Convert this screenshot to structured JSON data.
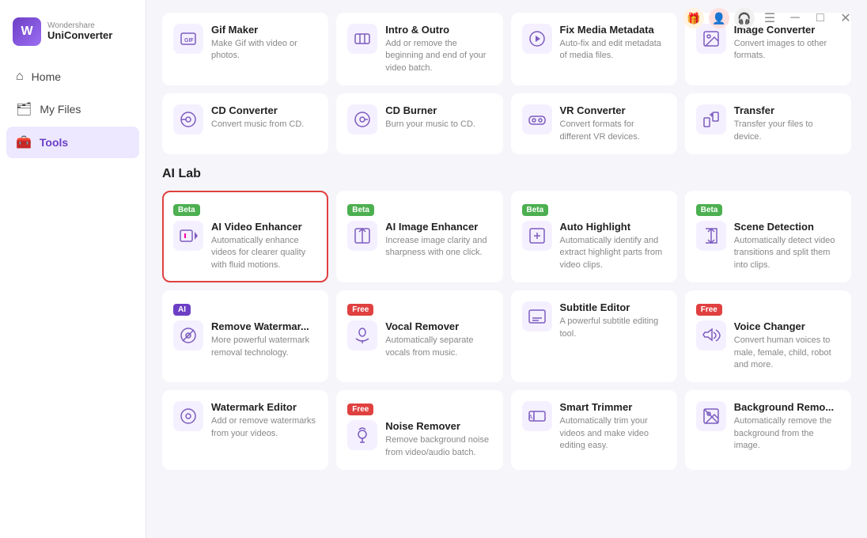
{
  "app": {
    "brand": "Wondershare",
    "product": "UniConverter"
  },
  "titlebar": {
    "gift": "🎁",
    "user": "👤",
    "support": "🎧",
    "menu": "☰",
    "minimize": "─",
    "maximize": "□",
    "close": "✕"
  },
  "sidebar": {
    "items": [
      {
        "id": "home",
        "label": "Home",
        "icon": "⌂"
      },
      {
        "id": "my-files",
        "label": "My Files",
        "icon": "🗂"
      },
      {
        "id": "tools",
        "label": "Tools",
        "icon": "🧰",
        "active": true
      }
    ]
  },
  "sections": [
    {
      "id": "more-tools",
      "title": "",
      "cards": [
        {
          "id": "gif-maker",
          "title": "Gif Maker",
          "desc": "Make Gif with video or photos.",
          "badge": null
        },
        {
          "id": "intro-outro",
          "title": "Intro & Outro",
          "desc": "Add or remove the beginning and end of your video batch.",
          "badge": null
        },
        {
          "id": "fix-media-metadata",
          "title": "Fix Media Metadata",
          "desc": "Auto-fix and edit metadata of media files.",
          "badge": null
        },
        {
          "id": "image-converter",
          "title": "Image Converter",
          "desc": "Convert images to other formats.",
          "badge": null
        },
        {
          "id": "cd-converter",
          "title": "CD Converter",
          "desc": "Convert music from CD.",
          "badge": null
        },
        {
          "id": "cd-burner",
          "title": "CD Burner",
          "desc": "Burn your music to CD.",
          "badge": null
        },
        {
          "id": "vr-converter",
          "title": "VR Converter",
          "desc": "Convert formats for different VR devices.",
          "badge": null
        },
        {
          "id": "transfer",
          "title": "Transfer",
          "desc": "Transfer your files to device.",
          "badge": null
        }
      ]
    },
    {
      "id": "ai-lab",
      "title": "AI Lab",
      "cards": [
        {
          "id": "ai-video-enhancer",
          "title": "AI Video Enhancer",
          "desc": "Automatically enhance videos for clearer quality with fluid motions.",
          "badge": "Beta",
          "highlighted": true
        },
        {
          "id": "ai-image-enhancer",
          "title": "AI Image Enhancer",
          "desc": "Increase image clarity and sharpness with one click.",
          "badge": "Beta"
        },
        {
          "id": "auto-highlight",
          "title": "Auto Highlight",
          "desc": "Automatically identify and extract highlight parts from video clips.",
          "badge": "Beta"
        },
        {
          "id": "scene-detection",
          "title": "Scene Detection",
          "desc": "Automatically detect video transitions and split them into clips.",
          "badge": "Beta"
        },
        {
          "id": "remove-watermark",
          "title": "Remove Watermar...",
          "desc": "More powerful watermark removal technology.",
          "badge": "AI"
        },
        {
          "id": "vocal-remover",
          "title": "Vocal Remover",
          "desc": "Automatically separate vocals from music.",
          "badge": "Free"
        },
        {
          "id": "subtitle-editor",
          "title": "Subtitle Editor",
          "desc": "A powerful subtitle editing tool.",
          "badge": null
        },
        {
          "id": "voice-changer",
          "title": "Voice Changer",
          "desc": "Convert human voices to male, female, child, robot and more.",
          "badge": "Free"
        },
        {
          "id": "watermark-editor",
          "title": "Watermark Editor",
          "desc": "Add or remove watermarks from your videos.",
          "badge": null
        },
        {
          "id": "noise-remover",
          "title": "Noise Remover",
          "desc": "Remove background noise from video/audio batch.",
          "badge": "Free"
        },
        {
          "id": "smart-trimmer",
          "title": "Smart Trimmer",
          "desc": "Automatically trim your videos and make video editing easy.",
          "badge": null
        },
        {
          "id": "background-remo",
          "title": "Background Remo...",
          "desc": "Automatically remove the background from the image.",
          "badge": null
        }
      ]
    }
  ]
}
